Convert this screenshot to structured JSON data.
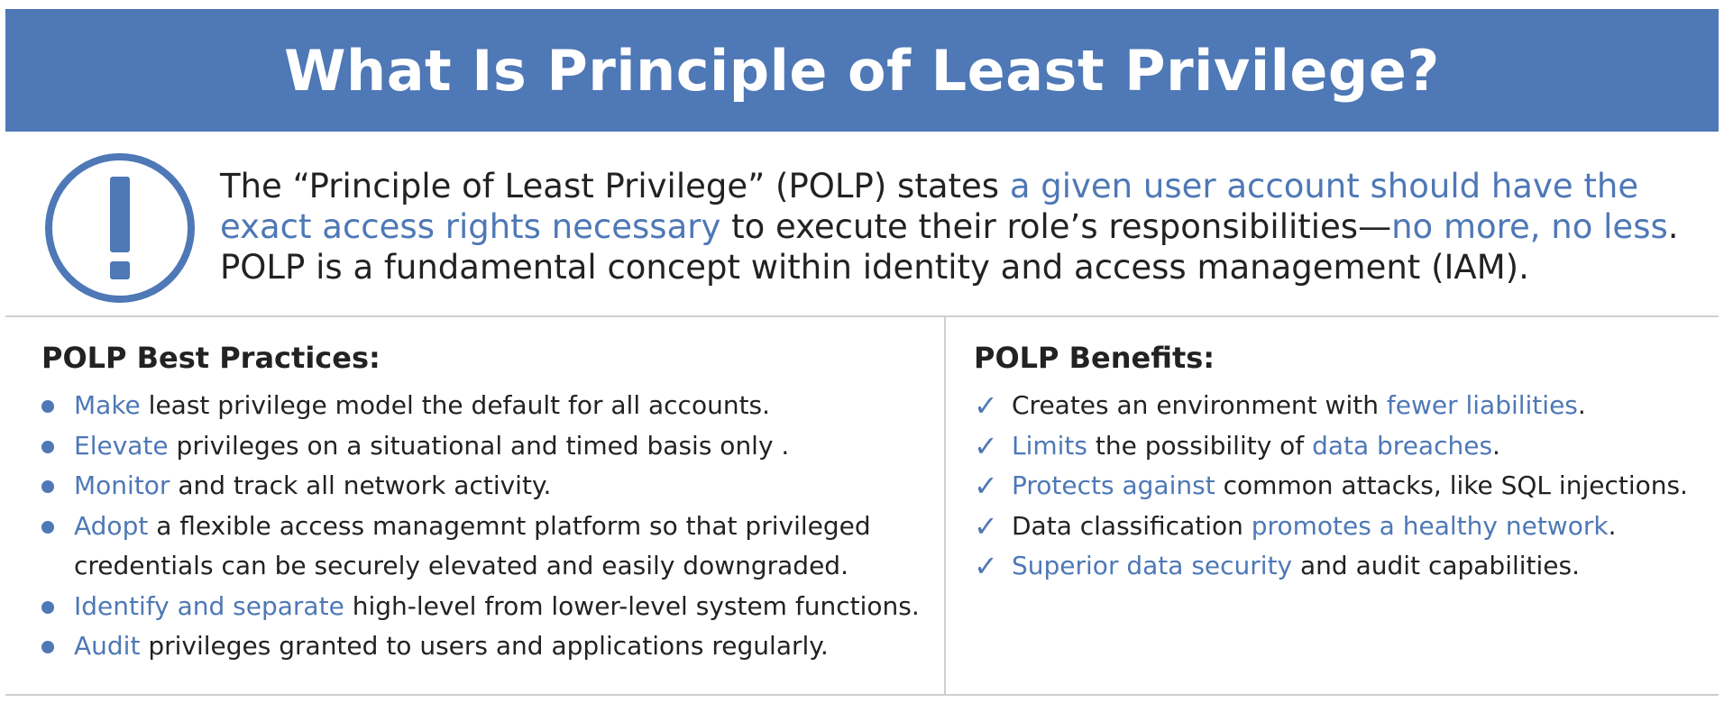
{
  "colors": {
    "accent": "#4e78b6",
    "text": "#222222",
    "rule": "#cfcfcf",
    "banner_text": "#ffffff"
  },
  "icons": {
    "alert": "exclamation-circle-icon",
    "bullet": "dot-bullet",
    "benefit": "check-icon"
  },
  "title": "What Is Principle of Least Privilege?",
  "intro": {
    "p1": "The “Principle of Least Privilege” (POLP) states ",
    "h1": "a given user account should have the exact access rights necessary",
    "p2": " to execute their role’s responsibilities—",
    "h2": "no more, no less",
    "p3": ". POLP is a fundamental concept within identity and access management (IAM)."
  },
  "practices": {
    "heading": "POLP Best Practices:",
    "items": [
      {
        "hl": "Make",
        "text": " least privilege model the default for all accounts."
      },
      {
        "hl": "Elevate",
        "text": " privileges on a situational and timed basis only ."
      },
      {
        "hl": "Monitor",
        "text": " and track all network activity."
      },
      {
        "hl": "Adopt",
        "text": " a flexible access managemnt platform so that privileged",
        "text2": "credentials can be securely elevated and easily downgraded."
      },
      {
        "hl": "Identify and separate",
        "text": " high-level from lower-level system functions."
      },
      {
        "hl": "Audit",
        "text": " privileges granted to users and applications regularly."
      }
    ]
  },
  "benefits": {
    "heading": "POLP Benefits:",
    "check": "✓",
    "items": [
      {
        "t1": "Creates an environment with ",
        "hl": "fewer liabilities",
        "t2": "."
      },
      {
        "t1": "",
        "hl": "Limits",
        "t2": " the possibility of ",
        "hl2": "data breaches",
        "t3": "."
      },
      {
        "t1": "",
        "hl": "Protects against",
        "t2": " common attacks, like SQL injections."
      },
      {
        "t1": "Data classification ",
        "hl": "promotes a healthy network",
        "t2": "."
      },
      {
        "t1": "",
        "hl": "Superior data security",
        "t2": " and audit capabilities."
      }
    ]
  }
}
